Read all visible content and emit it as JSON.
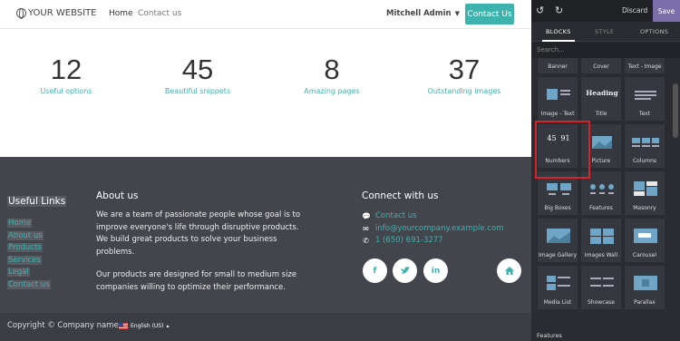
{
  "site": {
    "logo": "YOUR WEBSITE",
    "nav": {
      "home": "Home",
      "contact": "Contact us"
    },
    "user": "Mitchell Admin",
    "cta": "Contact Us",
    "stats": [
      {
        "num": "12",
        "label": "Useful options"
      },
      {
        "num": "45",
        "label": "Beautiful snippets"
      },
      {
        "num": "8",
        "label": "Amazing pages"
      },
      {
        "num": "37",
        "label": "Outstanding images"
      }
    ],
    "footer": {
      "links_title": "Useful Links",
      "links": [
        "Home",
        "About us",
        "Products",
        "Services",
        "Legal",
        "Contact us"
      ],
      "about_title": "About us",
      "about_p1": "We are a team of passionate people whose goal is to improve everyone's life through disruptive products. We build great products to solve your business problems.",
      "about_p2": "Our products are designed for small to medium size companies willing to optimize their performance.",
      "connect_title": "Connect with us",
      "contact_us": "Contact us",
      "email": "info@yourcompany.example.com",
      "phone": "1 (650) 691-3277",
      "social": [
        "f",
        "t",
        "in",
        "home"
      ]
    },
    "copyright": "Copyright © Company name",
    "language": "English (US)"
  },
  "editor": {
    "discard": "Discard",
    "save": "Save",
    "tabs": [
      "BLOCKS",
      "STYLE",
      "OPTIONS"
    ],
    "search_placeholder": "Search...",
    "blocks": [
      "Banner",
      "Cover",
      "Text - Image",
      "Image - Text",
      "Title",
      "Text",
      "Numbers",
      "Picture",
      "Columns",
      "Big Boxes",
      "Features",
      "Masonry",
      "Image Gallery",
      "Images Wall",
      "Carousel",
      "Media List",
      "Showcase",
      "Parallax"
    ],
    "numbers_thumb": [
      "45",
      "91"
    ],
    "title_thumb": "Heading",
    "section_label": "Features"
  },
  "colors": {
    "accent": "#3eb2ad",
    "save": "#7b6eaa",
    "highlight": "#d9232b",
    "footer": "#43454d"
  }
}
